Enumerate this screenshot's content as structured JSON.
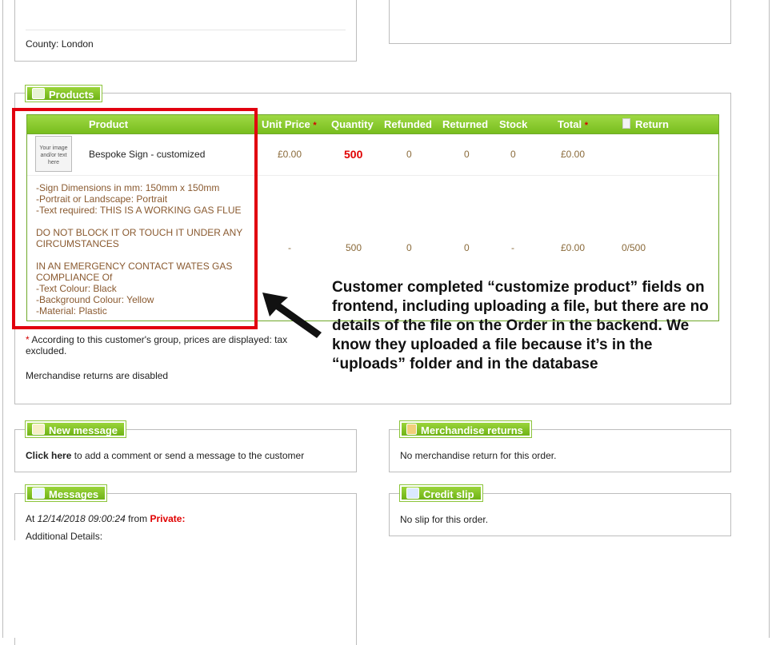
{
  "address": {
    "county": "County: London"
  },
  "products": {
    "legend": "Products",
    "columns": {
      "product": "Product",
      "unit_price": "Unit Price",
      "quantity": "Quantity",
      "refunded": "Refunded",
      "returned": "Returned",
      "stock": "Stock",
      "total": "Total",
      "return": "Return",
      "star": "*"
    },
    "row": {
      "thumb_text": "Your image and/or text here",
      "name": "Bespoke Sign - customized",
      "unit_price": "£0.00",
      "quantity": "500",
      "refunded": "0",
      "returned": "0",
      "stock": "0",
      "total": "£0.00"
    },
    "customization": {
      "lines": [
        "-Sign Dimensions in mm: 150mm x 150mm",
        "-Portrait or Landscape: Portrait",
        "-Text required: THIS IS A WORKING GAS FLUE",
        "",
        "DO NOT BLOCK IT OR TOUCH IT UNDER ANY",
        "CIRCUMSTANCES",
        "",
        "IN AN EMERGENCY CONTACT WATES GAS",
        "COMPLIANCE Of",
        "-Text Colour: Black",
        "-Background Colour: Yellow",
        "-Material: Plastic"
      ],
      "unit_price": "-",
      "quantity": "500",
      "refunded": "0",
      "returned": "0",
      "stock": "-",
      "total": "£0.00",
      "return": "0/500"
    },
    "note_star": "*",
    "note_line1": " According to this customer's group, prices are displayed: tax",
    "note_line2": "excluded.",
    "returns_disabled": "Merchandise returns are disabled"
  },
  "annotation": {
    "text": "Customer completed “customize product” fields on frontend, including uploading a file, but there are no details of the file on the Order in the backend. We know they uploaded a file because it’s in the “uploads” folder and in the database"
  },
  "new_message": {
    "legend": "New message",
    "link": "Click here",
    "text": " to add a comment or send a message to the customer"
  },
  "merchandise_returns": {
    "legend": "Merchandise returns",
    "text": "No merchandise return for this order."
  },
  "messages": {
    "legend": "Messages",
    "at": "At ",
    "date": "12/14/2018 09:00:24",
    "from": " from ",
    "private": "Private:",
    "details": "Additional Details:"
  },
  "credit_slip": {
    "legend": "Credit slip",
    "text": "No slip for this order."
  },
  "colors": {
    "accent": "#7dc122",
    "highlight": "#e1000f",
    "private": "#e00000"
  }
}
